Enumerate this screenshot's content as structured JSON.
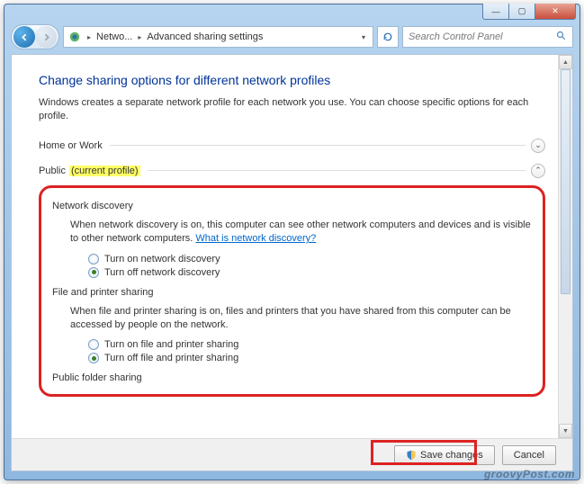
{
  "titlebar": {
    "min": "—",
    "max": "▢",
    "close": "✕"
  },
  "nav": {
    "crumb1": "Netwo...",
    "crumb2": "Advanced sharing settings",
    "search_placeholder": "Search Control Panel"
  },
  "page": {
    "heading": "Change sharing options for different network profiles",
    "subtext": "Windows creates a separate network profile for each network you use. You can choose specific options for each profile."
  },
  "sections": {
    "home_work": "Home or Work",
    "public": "Public",
    "public_tag": "(current profile)"
  },
  "network_discovery": {
    "title": "Network discovery",
    "desc": "When network discovery is on, this computer can see other network computers and devices and is visible to other network computers.",
    "link": "What is network discovery?",
    "opt_on": "Turn on network discovery",
    "opt_off": "Turn off network discovery",
    "selected": "off"
  },
  "file_printer": {
    "title": "File and printer sharing",
    "desc": "When file and printer sharing is on, files and printers that you have shared from this computer can be accessed by people on the network.",
    "opt_on": "Turn on file and printer sharing",
    "opt_off": "Turn off file and printer sharing",
    "selected": "off"
  },
  "public_folder": {
    "title": "Public folder sharing"
  },
  "footer": {
    "save": "Save changes",
    "cancel": "Cancel"
  },
  "watermark": "groovyPost.com"
}
